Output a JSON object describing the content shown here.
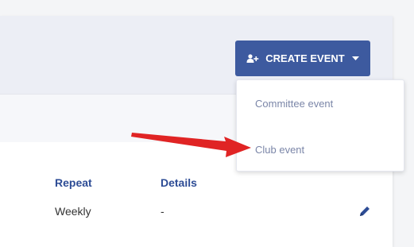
{
  "toolbar": {
    "create_event_label": "CREATE EVENT"
  },
  "dropdown": {
    "items": [
      {
        "label": "Committee event"
      },
      {
        "label": "Club event"
      }
    ]
  },
  "table": {
    "headers": [
      "Repeat",
      "Details"
    ],
    "rows": [
      {
        "repeat": "Weekly",
        "details": "-"
      }
    ]
  },
  "icons": {
    "create_button_icon": "user-plus-icon",
    "caret": "caret-down-icon",
    "edit": "pencil-icon"
  },
  "colors": {
    "primary": "#3d5a9f",
    "link_header": "#2d4c95",
    "menu_text": "#7b86a8",
    "annotation_arrow": "#e02424"
  }
}
